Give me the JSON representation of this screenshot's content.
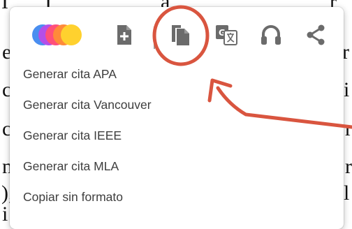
{
  "menu": {
    "items": [
      {
        "label": "Generar cita APA"
      },
      {
        "label": "Generar cita Vancouver"
      },
      {
        "label": "Generar cita IEEE"
      },
      {
        "label": "Generar cita MLA"
      },
      {
        "label": "Copiar sin formato"
      }
    ]
  },
  "toolbar": {
    "icons": [
      "color-circles-icon",
      "new-document-icon",
      "copy-icon",
      "translate-icon",
      "headphones-icon",
      "share-icon"
    ]
  },
  "colors": {
    "icon_gray": "#6b6b6b",
    "annotation_red": "#d9553f",
    "menu_text": "#3e3e3e"
  }
}
